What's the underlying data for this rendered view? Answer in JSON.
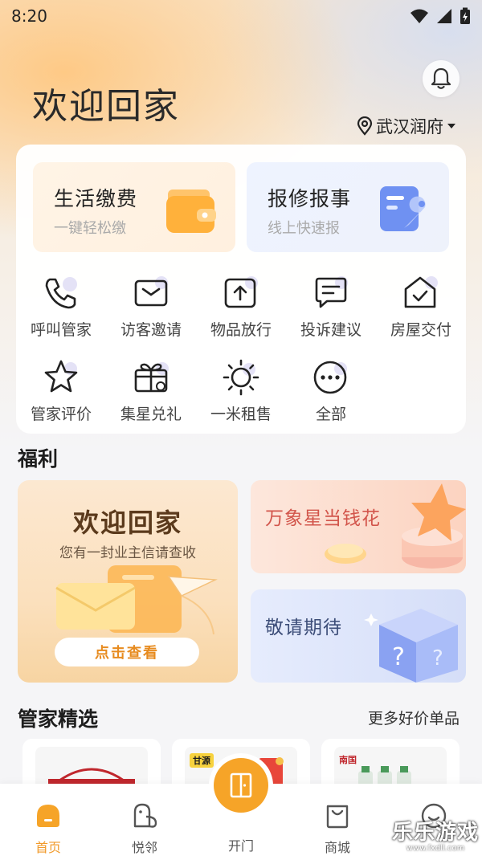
{
  "status_bar": {
    "time": "8:20"
  },
  "header": {
    "title": "欢迎回家",
    "location": "武汉润府"
  },
  "features": [
    {
      "title": "生活缴费",
      "subtitle": "一键轻松缴"
    },
    {
      "title": "报修报事",
      "subtitle": "线上快速报"
    }
  ],
  "services": [
    {
      "label": "呼叫管家",
      "icon": "phone-icon"
    },
    {
      "label": "访客邀请",
      "icon": "mail-icon"
    },
    {
      "label": "物品放行",
      "icon": "upload-box-icon"
    },
    {
      "label": "投诉建议",
      "icon": "chat-icon"
    },
    {
      "label": "房屋交付",
      "icon": "house-check-icon"
    },
    {
      "label": "管家评价",
      "icon": "star-icon"
    },
    {
      "label": "集星兑礼",
      "icon": "gift-icon"
    },
    {
      "label": "一米租售",
      "icon": "sun-icon"
    },
    {
      "label": "全部",
      "icon": "more-icon"
    }
  ],
  "welfare": {
    "title": "福利",
    "big_card": {
      "title": "欢迎回家",
      "subtitle": "您有一封业主信请查收",
      "button": "点击查看"
    },
    "card_stars": {
      "title": "万象星当钱花"
    },
    "card_soon": {
      "title": "敬请期待"
    }
  },
  "picks": {
    "title": "管家精选",
    "more": "更多好价单品",
    "products": [
      {
        "brand": ""
      },
      {
        "brand": "甘源"
      },
      {
        "brand": "南国"
      }
    ]
  },
  "tabbar": {
    "items": [
      {
        "label": "首页",
        "active": true
      },
      {
        "label": "悦邻",
        "active": false
      },
      {
        "label": "开门",
        "active": false
      },
      {
        "label": "商城",
        "active": false
      }
    ]
  },
  "watermark": {
    "text": "乐乐游戏",
    "url": "www.fxdll.com"
  },
  "colors": {
    "accent": "#f6a428",
    "active_tab": "#f19a2a"
  }
}
